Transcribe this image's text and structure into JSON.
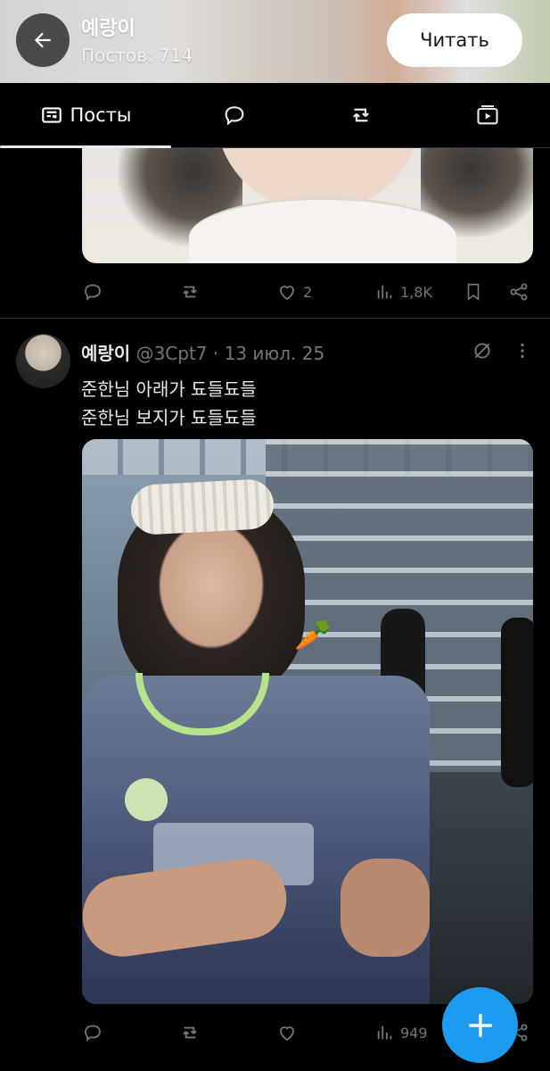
{
  "header": {
    "title": "예랑이",
    "subtitle": "Постов: 714",
    "follow_label": "Читать"
  },
  "tabs": [
    {
      "label": "Посты",
      "icon": "posts-icon",
      "active": true
    },
    {
      "label": "",
      "icon": "replies-icon"
    },
    {
      "label": "",
      "icon": "retweet-icon"
    },
    {
      "label": "",
      "icon": "media-icon"
    }
  ],
  "post1": {
    "actions": {
      "likes": "2",
      "views": "1,8K"
    }
  },
  "post2": {
    "name": "예랑이",
    "meta": "@3Cpt7 · 13 июл. 25",
    "text_line1": "준한님 아래가 됴들됴들",
    "text_line2": "준한님 보지가 됴들됴들",
    "media_emoji": "🥕",
    "actions": {
      "views": "949"
    }
  },
  "colors": {
    "accent": "#1d9bf0",
    "muted": "#71767b",
    "background": "#000000"
  }
}
